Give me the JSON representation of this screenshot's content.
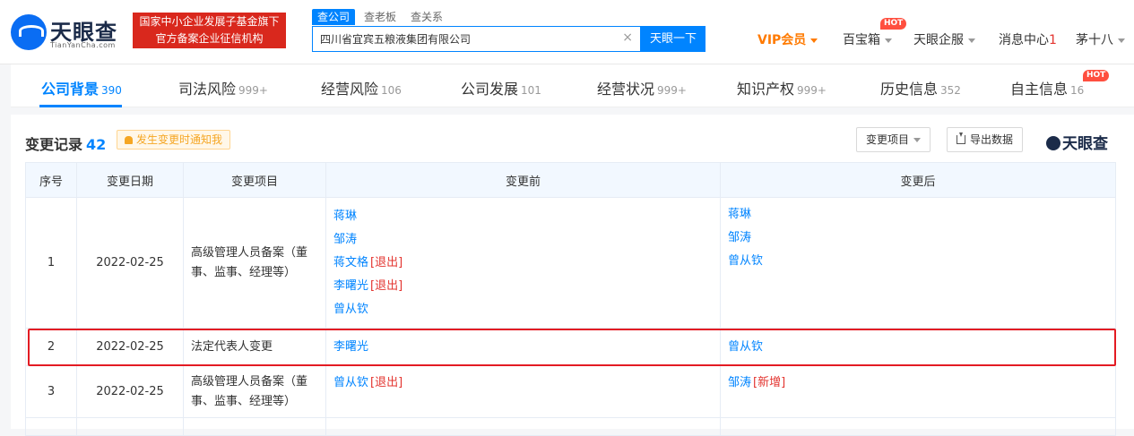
{
  "header": {
    "logo_title": "天眼查",
    "logo_domain": "TianYanCha.com",
    "gov_badge_line1": "国家中小企业发展子基金旗下",
    "gov_badge_line2": "官方备案企业征信机构",
    "search_tabs": [
      "查公司",
      "查老板",
      "查关系"
    ],
    "search_value": "四川省宜宾五粮液集团有限公司",
    "search_button": "天眼一下",
    "vip": "VIP会员",
    "nav": {
      "treasure": "百宝箱",
      "treasure_badge": "HOT",
      "enterprise_service": "天眼企服",
      "messages": "消息中心",
      "message_count": "1",
      "user": "茅十八"
    }
  },
  "tabs": [
    {
      "label": "公司背景",
      "count": "390"
    },
    {
      "label": "司法风险",
      "count": "999+"
    },
    {
      "label": "经营风险",
      "count": "106"
    },
    {
      "label": "公司发展",
      "count": "101"
    },
    {
      "label": "经营状况",
      "count": "999+"
    },
    {
      "label": "知识产权",
      "count": "999+"
    },
    {
      "label": "历史信息",
      "count": "352"
    },
    {
      "label": "自主信息",
      "count": "16",
      "badge": "HOT"
    }
  ],
  "section": {
    "title": "变更记录",
    "count": "42",
    "notify": "发生变更时通知我",
    "filter": "变更项目",
    "export": "导出数据",
    "watermark": "天眼查"
  },
  "table": {
    "headers": [
      "序号",
      "变更日期",
      "变更项目",
      "变更前",
      "变更后"
    ],
    "exit_tag": "[退出]",
    "new_tag": "[新增]",
    "rows": [
      {
        "no": "1",
        "date": "2022-02-25",
        "item": "高级管理人员备案（董事、监事、经理等）",
        "before": [
          "蒋琳",
          "邹涛",
          "蒋文格",
          "李曙光",
          "曾从钦"
        ],
        "after": [
          "蒋琳",
          "邹涛",
          "曾从钦"
        ]
      },
      {
        "no": "2",
        "date": "2022-02-25",
        "item": "法定代表人变更",
        "before": [
          "李曙光"
        ],
        "after": [
          "曾从钦"
        ]
      },
      {
        "no": "3",
        "date": "2022-02-25",
        "item": "高级管理人员备案（董事、监事、经理等）",
        "before": [
          "曾从钦"
        ],
        "after": [
          "邹涛"
        ]
      }
    ]
  },
  "colors": {
    "accent": "#0084ff",
    "badge_red": "#d9281d",
    "vip_orange": "#ff7a00",
    "highlight": "#e31b23"
  }
}
